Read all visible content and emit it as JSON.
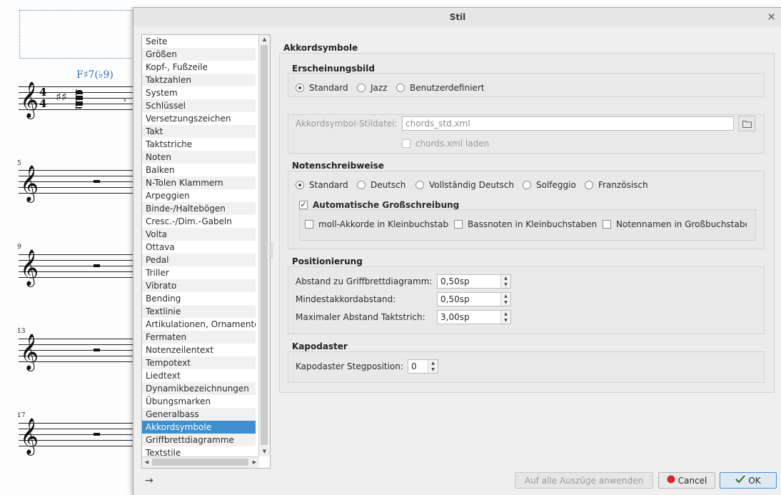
{
  "score": {
    "chord_symbol": "F♯7(♭9)",
    "time_signature": {
      "top": "4",
      "bottom": "4"
    },
    "key_accidentals": "♯♯",
    "measure_numbers": [
      "5",
      "9",
      "13",
      "17"
    ],
    "treble_clef": "𝄞"
  },
  "dialog": {
    "title": "Stil",
    "close_icon": "×",
    "nav_arrow": "→"
  },
  "sidebar": {
    "items": [
      "Seite",
      "Größen",
      "Kopf-, Fußzeile",
      "Taktzahlen",
      "System",
      "Schlüssel",
      "Versetzungszeichen",
      "Takt",
      "Taktstriche",
      "Noten",
      "Balken",
      "N-Tolen Klammern",
      "Arpeggien",
      "Binde-/Haltebögen",
      "Cresc.-/Dim.-Gabeln",
      "Volta",
      "Ottava",
      "Pedal",
      "Triller",
      "Vibrato",
      "Bending",
      "Textlinie",
      "Artikulationen, Ornamente",
      "Fermaten",
      "Notenzeilentext",
      "Tempotext",
      "Liedtext",
      "Dynamikbezeichnungen",
      "Übungsmarken",
      "Generalbass",
      "Akkordsymbole",
      "Griffbrettdiagramme",
      "Textstile"
    ],
    "selected": "Akkordsymbole"
  },
  "page": {
    "title": "Akkordsymbole",
    "appearance": {
      "title": "Erscheinungsbild",
      "options": [
        "Standard",
        "Jazz",
        "Benutzerdefiniert"
      ],
      "selected": "Standard"
    },
    "stylefile": {
      "label": "Akkordsymbol-Stildatei:",
      "value": "chords_std.xml",
      "load_label": "chords.xml laden",
      "folder_icon": "folder-icon"
    },
    "notation": {
      "title": "Notenschreibweise",
      "options": [
        "Standard",
        "Deutsch",
        "Vollständig Deutsch",
        "Solfeggio",
        "Französisch"
      ],
      "selected": "Standard",
      "autocap_label": "Automatische Großschreibung",
      "autocap_checked": true,
      "sub_options": [
        "moll-Akkorde in Kleinbuchstaben",
        "Bassnoten in Kleinbuchstaben",
        "Notennamen in Großbuchstaben"
      ]
    },
    "positioning": {
      "title": "Positionierung",
      "fields": [
        {
          "label": "Abstand zu Griffbrettdiagramm:",
          "value": "0,50sp"
        },
        {
          "label": "Mindestakkordabstand:",
          "value": "0,50sp"
        },
        {
          "label": "Maximaler Abstand Taktstrich:",
          "value": "3,00sp"
        }
      ]
    },
    "capo": {
      "title": "Kapodaster",
      "label": "Kapodaster Stegposition:",
      "value": "0"
    }
  },
  "footer": {
    "apply_all_label": "Auf alle Auszüge anwenden",
    "cancel_label": "Cancel",
    "ok_label": "OK"
  }
}
